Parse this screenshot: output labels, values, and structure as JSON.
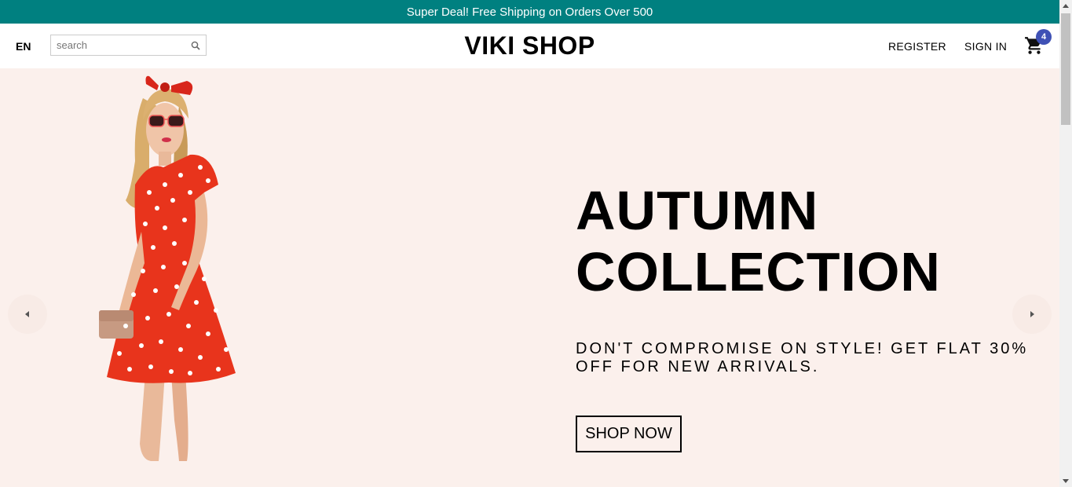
{
  "announcement": {
    "text": "Super Deal! Free Shipping on Orders Over 500"
  },
  "header": {
    "language": "EN",
    "search": {
      "placeholder": "search",
      "value": ""
    },
    "logo": "VIKI SHOP",
    "nav": {
      "register": "REGISTER",
      "sign_in": "SIGN IN"
    },
    "cart": {
      "icon": "cart-icon",
      "count": "4"
    }
  },
  "slider": {
    "title_line1": "AUTUMN",
    "title_line2": "COLLECTION",
    "description": "DON'T COMPROMISE ON STYLE! GET FLAT 30% OFF FOR NEW ARRIVALS.",
    "cta_label": "SHOP NOW",
    "image": "woman-red-polka-dot-dress",
    "prev_icon": "arrow-left-icon",
    "next_icon": "arrow-right-icon"
  },
  "colors": {
    "announcement_bg": "#008080",
    "hero_bg": "#fbf0ec",
    "badge_bg": "#3f51b5",
    "dress_red": "#e8341c"
  }
}
